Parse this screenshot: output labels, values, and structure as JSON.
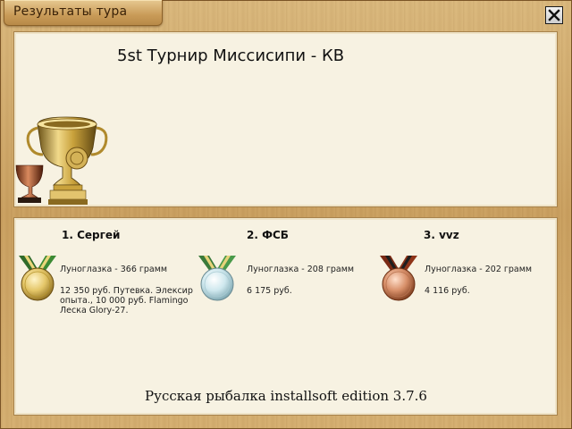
{
  "window": {
    "title": "Результаты тура",
    "close_icon": "close-icon"
  },
  "tournament": {
    "title": "5st Турнир Миссисипи - КВ",
    "image_icon": "trophy-cups-icon"
  },
  "winners": [
    {
      "place_name": "1. Сергей",
      "medal": "gold-medal-icon",
      "catch": "Луноглазка - 366 грамм",
      "prize": "12 350 руб. Путевка. Элексир опыта., 10 000 руб. Flamingo Леска Glory-27."
    },
    {
      "place_name": "2. ФСБ",
      "medal": "silver-medal-icon",
      "catch": "Луноглазка - 208 грамм",
      "prize": "6 175 руб."
    },
    {
      "place_name": "3. vvz",
      "medal": "bronze-medal-icon",
      "catch": "Луноглазка - 202 грамм",
      "prize": "4 116 руб."
    }
  ],
  "footer": {
    "text": "Русская рыбалка installsoft edition 3.7.6"
  },
  "colors": {
    "frame": "#c99f5f",
    "panel": "#f7f2e2",
    "gold": "#d8b64a",
    "silver": "#bfe0e6",
    "bronze": "#c77a55"
  }
}
